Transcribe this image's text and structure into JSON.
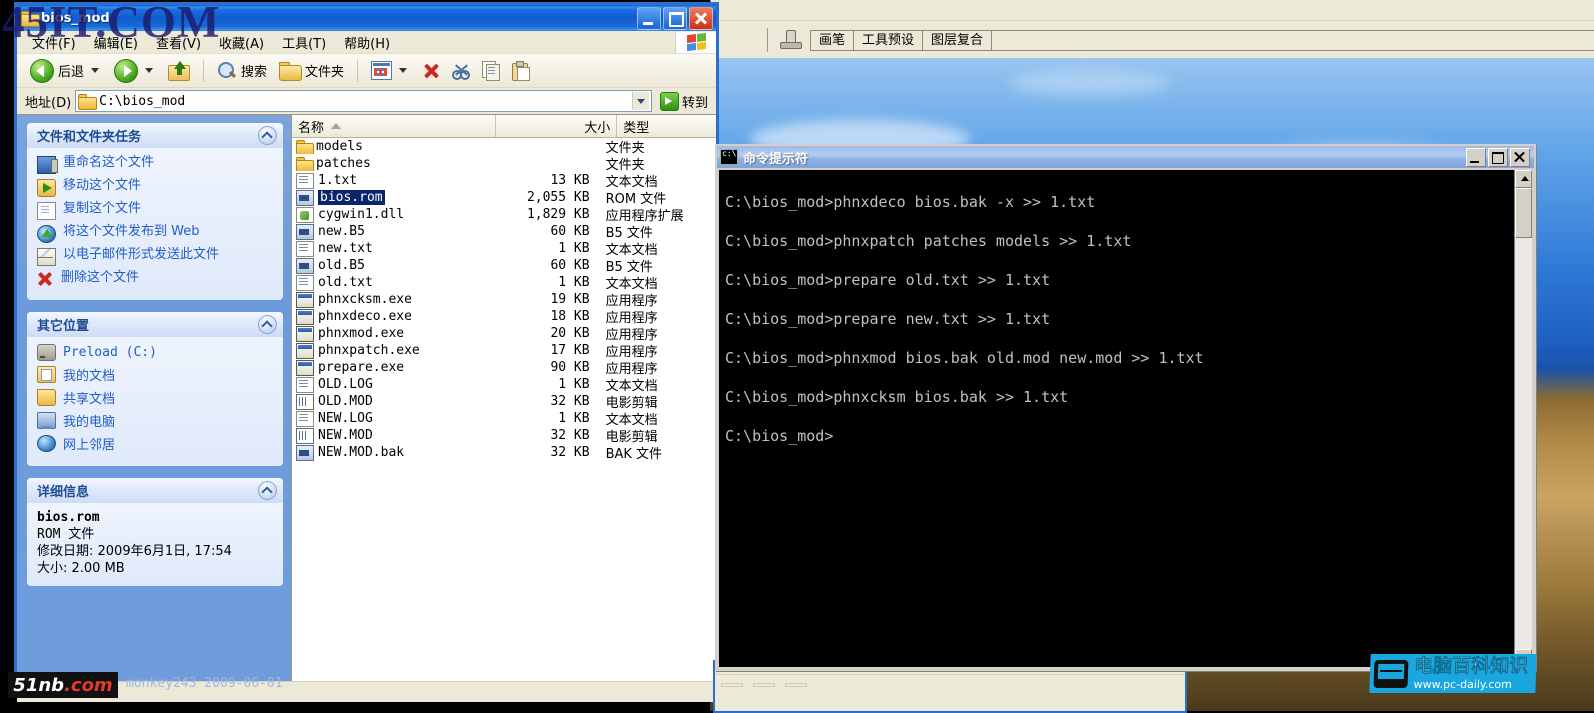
{
  "explorer": {
    "title": "bios_mod",
    "window_icon": "folder-icon",
    "menu": [
      {
        "label": "文件(F)"
      },
      {
        "label": "编辑(E)"
      },
      {
        "label": "查看(V)"
      },
      {
        "label": "收藏(A)"
      },
      {
        "label": "工具(T)"
      },
      {
        "label": "帮助(H)"
      }
    ],
    "toolbar": {
      "back": "后退",
      "search": "搜索",
      "folders": "文件夹"
    },
    "address": {
      "label": "地址(D)",
      "value": "C:\\bios_mod",
      "go": "转到"
    },
    "sidebar": {
      "tasks_panel": {
        "title": "文件和文件夹任务",
        "items": [
          {
            "label": "重命名这个文件",
            "icon": "rename-icon"
          },
          {
            "label": "移动这个文件",
            "icon": "move-icon"
          },
          {
            "label": "复制这个文件",
            "icon": "copy-icon"
          },
          {
            "label": "将这个文件发布到 Web",
            "icon": "publish-web-icon"
          },
          {
            "label": "以电子邮件形式发送此文件",
            "icon": "email-icon"
          },
          {
            "label": "删除这个文件",
            "icon": "delete-icon"
          }
        ]
      },
      "places_panel": {
        "title": "其它位置",
        "items": [
          {
            "label": "Preload (C:)",
            "icon": "drive-icon"
          },
          {
            "label": "我的文档",
            "icon": "my-documents-icon"
          },
          {
            "label": "共享文档",
            "icon": "shared-documents-icon"
          },
          {
            "label": "我的电脑",
            "icon": "my-computer-icon"
          },
          {
            "label": "网上邻居",
            "icon": "network-icon"
          }
        ]
      },
      "details_panel": {
        "title": "详细信息",
        "file_name": "bios.rom",
        "file_type": "ROM 文件",
        "modified": "修改日期: 2009年6月1日, 17:54",
        "size": "大小: 2.00 MB"
      }
    },
    "columns": {
      "name": "名称",
      "size": "大小",
      "type": "类型"
    },
    "files": [
      {
        "name": "models",
        "size": "",
        "type": "文件夹",
        "icon": "folder-icon",
        "selected": false
      },
      {
        "name": "patches",
        "size": "",
        "type": "文件夹",
        "icon": "folder-icon",
        "selected": false
      },
      {
        "name": "1.txt",
        "size": "13 KB",
        "type": "文本文档",
        "icon": "text-icon",
        "selected": false
      },
      {
        "name": "bios.rom",
        "size": "2,055 KB",
        "type": "ROM 文件",
        "icon": "rom-icon",
        "selected": true
      },
      {
        "name": "cygwin1.dll",
        "size": "1,829 KB",
        "type": "应用程序扩展",
        "icon": "dll-icon",
        "selected": false
      },
      {
        "name": "new.B5",
        "size": "60 KB",
        "type": "B5 文件",
        "icon": "rom-icon",
        "selected": false
      },
      {
        "name": "new.txt",
        "size": "1 KB",
        "type": "文本文档",
        "icon": "text-icon",
        "selected": false
      },
      {
        "name": "old.B5",
        "size": "60 KB",
        "type": "B5 文件",
        "icon": "rom-icon",
        "selected": false
      },
      {
        "name": "old.txt",
        "size": "1 KB",
        "type": "文本文档",
        "icon": "text-icon",
        "selected": false
      },
      {
        "name": "phnxcksm.exe",
        "size": "19 KB",
        "type": "应用程序",
        "icon": "exe-icon",
        "selected": false
      },
      {
        "name": "phnxdeco.exe",
        "size": "18 KB",
        "type": "应用程序",
        "icon": "exe-icon",
        "selected": false
      },
      {
        "name": "phnxmod.exe",
        "size": "20 KB",
        "type": "应用程序",
        "icon": "exe-icon",
        "selected": false
      },
      {
        "name": "phnxpatch.exe",
        "size": "17 KB",
        "type": "应用程序",
        "icon": "exe-icon",
        "selected": false
      },
      {
        "name": "prepare.exe",
        "size": "90 KB",
        "type": "应用程序",
        "icon": "exe-icon",
        "selected": false
      },
      {
        "name": "OLD.LOG",
        "size": "1 KB",
        "type": "文本文档",
        "icon": "text-icon",
        "selected": false
      },
      {
        "name": "OLD.MOD",
        "size": "32 KB",
        "type": "电影剪辑",
        "icon": "mod-icon",
        "selected": false
      },
      {
        "name": "NEW.LOG",
        "size": "1 KB",
        "type": "文本文档",
        "icon": "text-icon",
        "selected": false
      },
      {
        "name": "NEW.MOD",
        "size": "32 KB",
        "type": "电影剪辑",
        "icon": "mod-icon",
        "selected": false
      },
      {
        "name": "NEW.MOD.bak",
        "size": "32 KB",
        "type": "BAK 文件",
        "icon": "bak-icon",
        "selected": false
      }
    ]
  },
  "photoshop": {
    "tabs": [
      {
        "label": "画笔"
      },
      {
        "label": "工具预设"
      },
      {
        "label": "图层复合"
      }
    ],
    "tool_icon": "clone-stamp-icon"
  },
  "cmd": {
    "title": "命令提示符",
    "icon": "console-icon",
    "lines": [
      "C:\\bios_mod>phnxdeco bios.bak -x >> 1.txt",
      "C:\\bios_mod>phnxpatch patches models >> 1.txt",
      "C:\\bios_mod>prepare old.txt >> 1.txt",
      "C:\\bios_mod>prepare new.txt >> 1.txt",
      "C:\\bios_mod>phnxmod bios.bak old.mod new.mod >> 1.txt",
      "C:\\bios_mod>phnxcksm bios.bak >> 1.txt",
      "C:\\bios_mod>"
    ]
  },
  "watermarks": {
    "top": "45IT.COM",
    "brand_51nb_a": "51",
    "brand_51nb_b": "nb",
    "brand_51nb_c": ".com",
    "user_stamp": "monkey243  2009-06-01",
    "pc_daily_cn": "电脑百科知识",
    "pc_daily_url": "www.pc-daily.com"
  }
}
